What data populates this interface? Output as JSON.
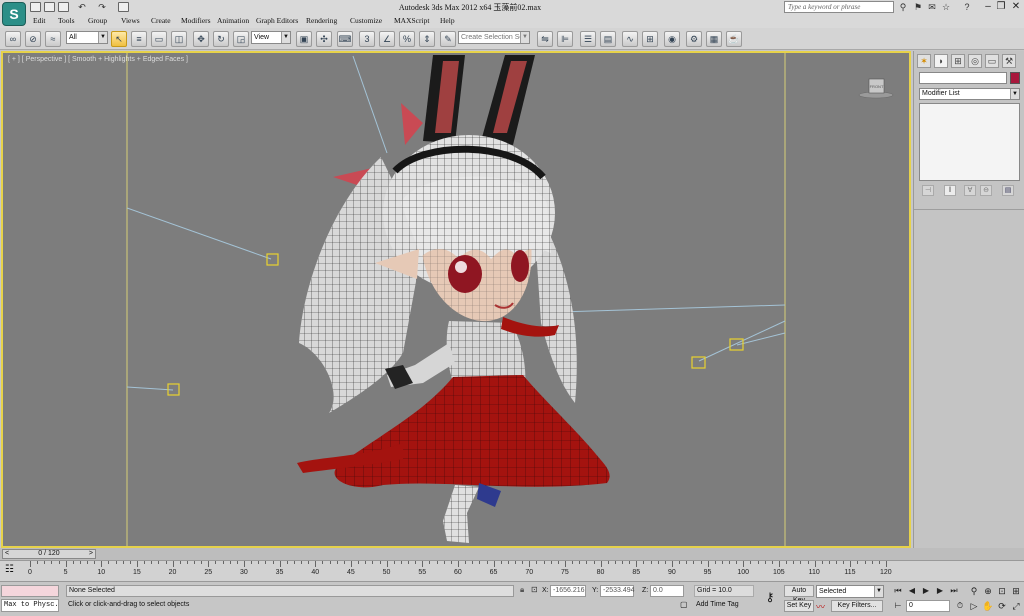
{
  "app": {
    "logo": "S",
    "title": "Autodesk 3ds Max  2012 x64     玉藻前02.max",
    "search_placeholder": "Type a keyword or phrase"
  },
  "menu": [
    "Edit",
    "Tools",
    "Group",
    "Views",
    "Create",
    "Modifiers",
    "Animation",
    "Graph Editors",
    "Rendering",
    "Customize",
    "MAXScript",
    "Help"
  ],
  "toolbar": {
    "selection_filter": "All",
    "ref_coord": "View",
    "selection_set_placeholder": "Create Selection Set"
  },
  "viewport": {
    "label": "[ + ] [ Perspective ] [ Smooth + Highlights + Edged Faces ]",
    "viewcube_face": "FRONT"
  },
  "command_panel": {
    "modifier_list": "Modifier List",
    "object_color": "#a8183c"
  },
  "timeline": {
    "slider_label": "0 / 120",
    "ticks": [
      0,
      5,
      10,
      15,
      20,
      25,
      30,
      35,
      40,
      45,
      50,
      55,
      60,
      65,
      70,
      75,
      80,
      85,
      90,
      95,
      100,
      105,
      110,
      115,
      120
    ],
    "max_frame": 120
  },
  "status": {
    "script_listener": "Max to Physc.",
    "selection": "None Selected",
    "prompt": "Click or click-and-drag to select objects",
    "x_label": "X:",
    "x_value": "-1656.216",
    "y_label": "Y:",
    "y_value": "-2533.494",
    "z_label": "Z:",
    "z_value": "0.0",
    "grid": "Grid = 10.0",
    "add_time_tag": "Add Time Tag",
    "auto_key": "Auto Key",
    "set_key": "Set Key",
    "key_mode": "Selected",
    "key_filters": "Key Filters...",
    "current_frame": "0"
  }
}
